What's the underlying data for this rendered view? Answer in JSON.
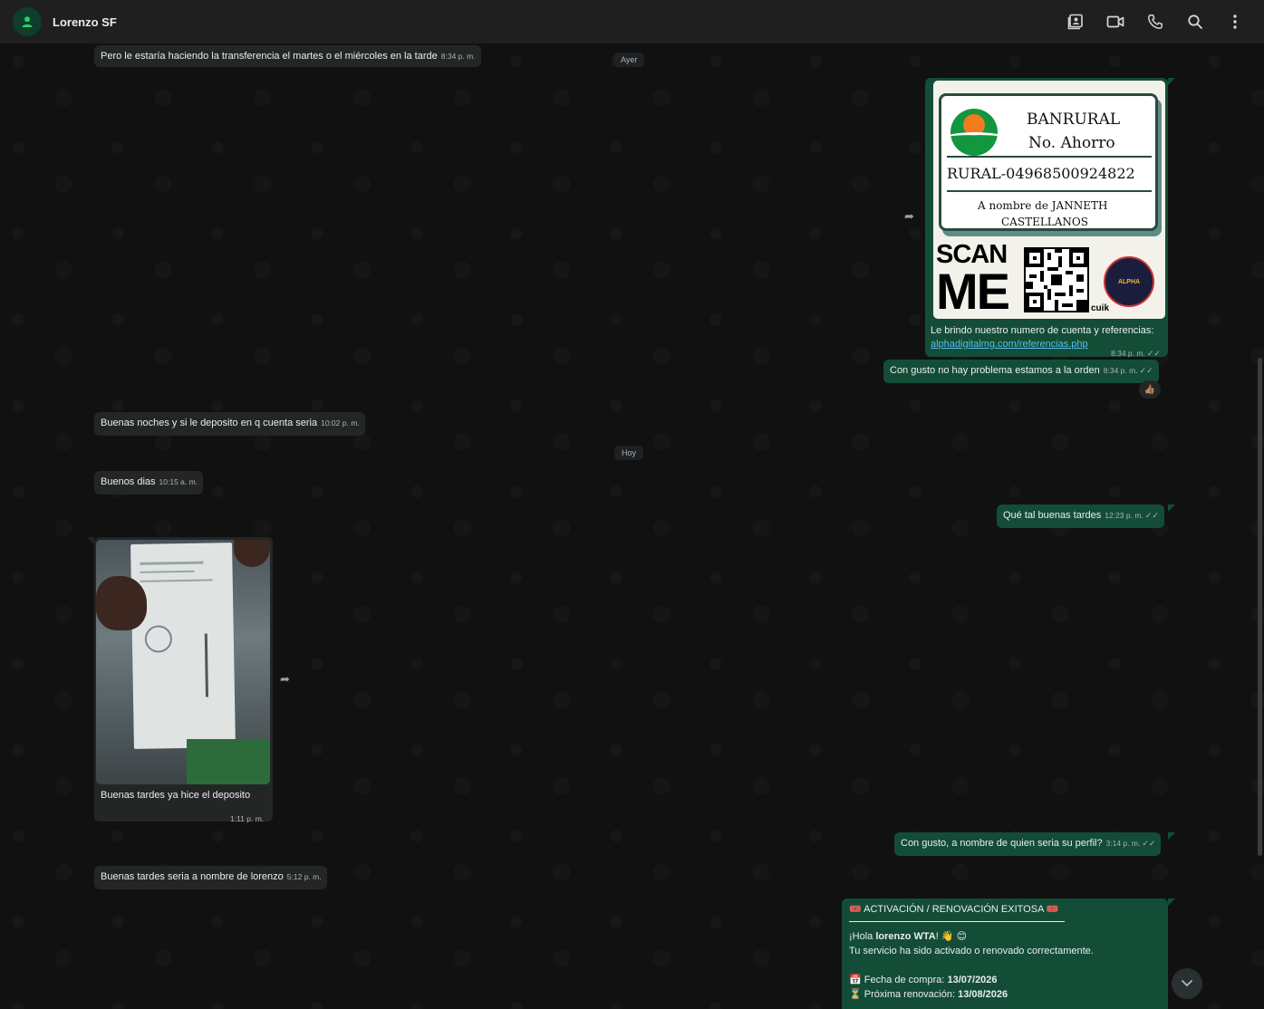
{
  "contact": {
    "name": "Lorenzo SF"
  },
  "header_icons": [
    "contact-card-icon",
    "video-call-icon",
    "voice-call-icon",
    "search-icon",
    "menu-icon"
  ],
  "days": {
    "yesterday": "Ayer",
    "today": "Hoy"
  },
  "messages": {
    "m1": {
      "text": "Pero le estaría haciendo la transferencia el martes o el miércoles en la tarde",
      "time": "8:34 p. m."
    },
    "m2": {
      "caption": "Le brindo nuestro numero de cuenta y referencias:",
      "link": "alphadigitalmg.com/referencias.php",
      "time": "8:34 p. m."
    },
    "m3": {
      "text": "Con gusto no hay problema estamos a la orden",
      "time": "8:34 p. m.",
      "reaction": "👍🏽"
    },
    "m4": {
      "text": "Buenas noches y si le deposito en q cuenta seria",
      "time": "10:02 p. m."
    },
    "m5": {
      "text": "Buenos dias",
      "time": "10:15 a. m."
    },
    "m6": {
      "text": "Qué tal buenas tardes",
      "time": "12:23 p. m."
    },
    "m7": {
      "caption": "Buenas tardes ya hice el deposito",
      "time": "1:11 p. m."
    },
    "m8": {
      "text": "Con gusto, a nombre de quien seria su perfil?",
      "time": "3:14 p. m."
    },
    "m9": {
      "text": "Buenas tardes seria a nombre de lorenzo",
      "time": "5:12 p. m."
    },
    "m10": {
      "title": "ACTIVACIÓN / RENOVACIÓN EXITOSA",
      "greet_pre": "¡Hola ",
      "greet_name": "lorenzo WTA",
      "greet_post": "! 👋 😊",
      "line1": "Tu servicio ha sido activado o renovado correctamente.",
      "purchase_label": "Fecha de compra: ",
      "purchase_date": "13/07/2026",
      "renew_label": "Próxima renovación: ",
      "renew_date": "13/08/2026",
      "emoji_ticket": "🎟️",
      "emoji_calendar": "📅",
      "emoji_hourglass": "⏳"
    }
  },
  "bank_image": {
    "bank": "BANRURAL",
    "account_type": "No. Ahorro",
    "account": "RURAL-04968500924822",
    "name_line1": "A nombre de JANNETH",
    "name_line2": "CASTELLANOS",
    "scan1": "SCAN",
    "scan2": "ME",
    "qr_brand": "cuik",
    "badge_text": "ALPHA"
  },
  "colors": {
    "outgoing": "#144d37",
    "incoming": "#242626",
    "accent": "#25d366",
    "link": "#53bdeb"
  }
}
